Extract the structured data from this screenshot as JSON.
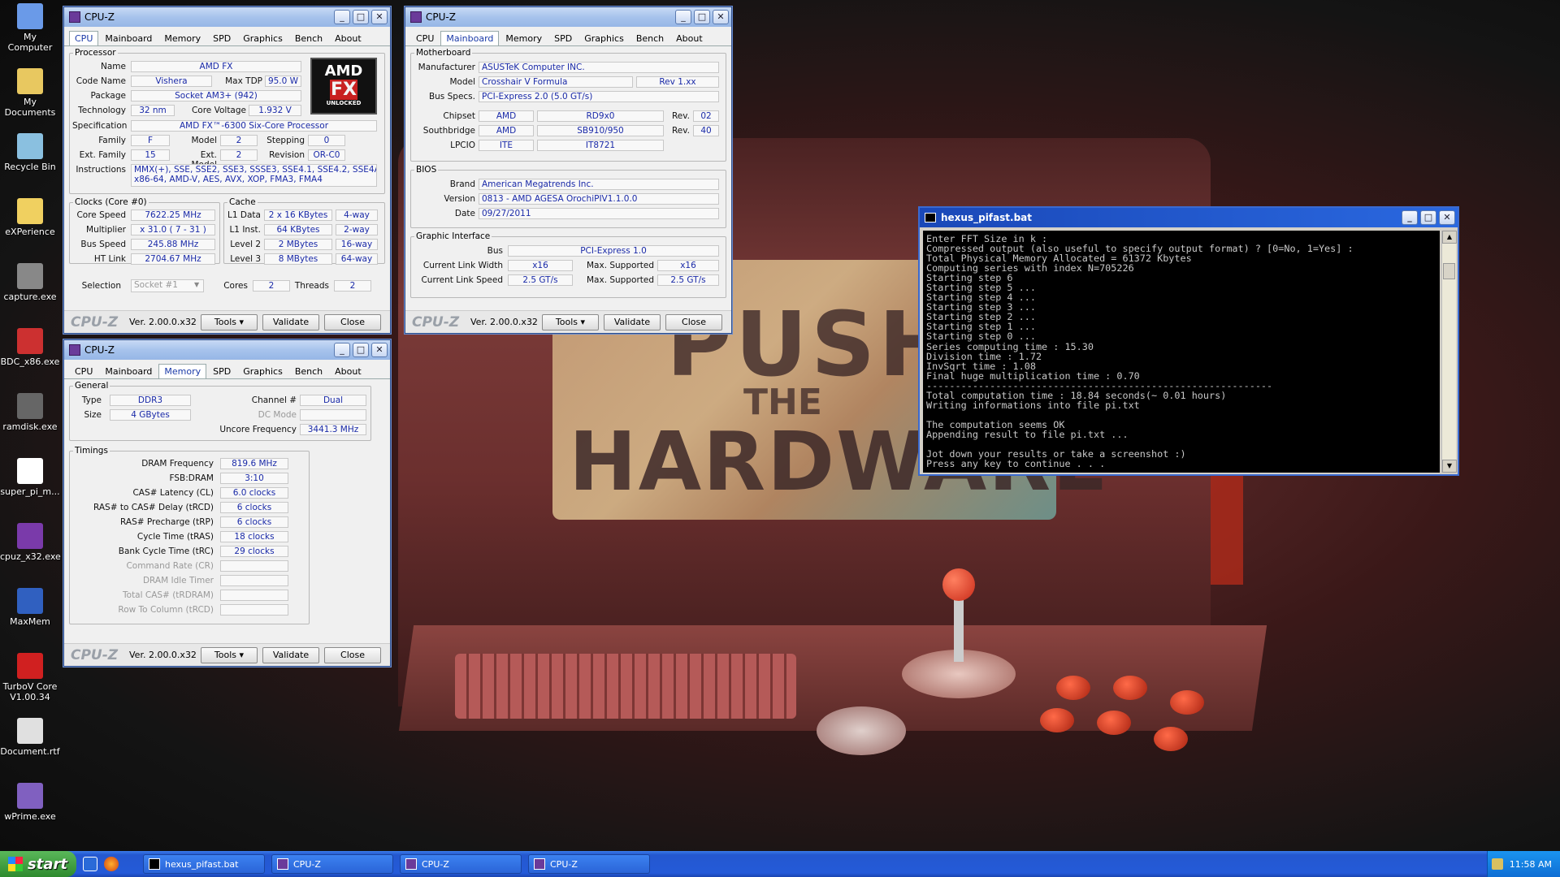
{
  "desktop": {
    "icons": [
      {
        "label": "My Computer",
        "icon": "computer-icon",
        "color": "#6a9ae8"
      },
      {
        "label": "My Documents",
        "icon": "documents-icon",
        "color": "#e8c860"
      },
      {
        "label": "Recycle Bin",
        "icon": "recycle-bin-icon",
        "color": "#8ac0e0"
      },
      {
        "label": "eXPerience",
        "icon": "folder-icon",
        "color": "#f0d060"
      },
      {
        "label": "capture.exe",
        "icon": "camera-icon",
        "color": "#888888"
      },
      {
        "label": "BDC_x86.exe",
        "icon": "app-icon",
        "color": "#cc3030"
      },
      {
        "label": "ramdisk.exe",
        "icon": "disk-icon",
        "color": "#666666"
      },
      {
        "label": "super_pi_m...",
        "icon": "pi-icon",
        "color": "#ffffff"
      },
      {
        "label": "cpuz_x32.exe",
        "icon": "cpu-icon",
        "color": "#7a3aaa"
      },
      {
        "label": "MaxMem",
        "icon": "memory-icon",
        "color": "#3060c0"
      },
      {
        "label": "TurboV Core V1.00.34",
        "icon": "turbo-icon",
        "color": "#d02020"
      },
      {
        "label": "Document.rtf",
        "icon": "document-icon",
        "color": "#e0e0e0"
      },
      {
        "label": "wPrime.exe",
        "icon": "wprime-icon",
        "color": "#8060c0"
      }
    ],
    "wallpaper_text": {
      "line1": "PUSH",
      "line2": "THE",
      "line3": "HARDWARE"
    }
  },
  "cpuz_cpu": {
    "title": "CPU-Z",
    "tabs": [
      "CPU",
      "Mainboard",
      "Memory",
      "SPD",
      "Graphics",
      "Bench",
      "About"
    ],
    "active_tab": "CPU",
    "processor": {
      "legend": "Processor",
      "name_label": "Name",
      "name": "AMD FX",
      "codename_label": "Code Name",
      "codename": "Vishera",
      "maxtdp_label": "Max TDP",
      "maxtdp": "95.0 W",
      "package_label": "Package",
      "package": "Socket AM3+ (942)",
      "technology_label": "Technology",
      "technology": "32 nm",
      "corevoltage_label": "Core Voltage",
      "corevoltage": "1.932 V",
      "spec_label": "Specification",
      "spec": "AMD FX™-6300 Six-Core Processor",
      "family_label": "Family",
      "family": "F",
      "model_label": "Model",
      "model": "2",
      "stepping_label": "Stepping",
      "stepping": "0",
      "extfamily_label": "Ext. Family",
      "extfamily": "15",
      "extmodel_label": "Ext. Model",
      "extmodel": "2",
      "revision_label": "Revision",
      "revision": "OR-C0",
      "instructions_label": "Instructions",
      "instructions_1": "MMX(+), SSE, SSE2, SSE3, SSSE3, SSE4.1, SSE4.2, SSE4A,",
      "instructions_2": "x86-64, AMD-V, AES, AVX, XOP, FMA3, FMA4",
      "logo_top": "AMD",
      "logo_mid": "FX",
      "logo_bottom": "UNLOCKED"
    },
    "clocks": {
      "legend": "Clocks (Core #0)",
      "corespeed_label": "Core Speed",
      "corespeed": "7622.25 MHz",
      "multiplier_label": "Multiplier",
      "multiplier": "x 31.0 ( 7 - 31 )",
      "busspeed_label": "Bus Speed",
      "busspeed": "245.88 MHz",
      "htlink_label": "HT Link",
      "htlink": "2704.67 MHz"
    },
    "cache": {
      "legend": "Cache",
      "l1d_label": "L1 Data",
      "l1d": "2 x 16 KBytes",
      "l1d_way": "4-way",
      "l1i_label": "L1 Inst.",
      "l1i": "64 KBytes",
      "l1i_way": "2-way",
      "l2_label": "Level 2",
      "l2": "2 MBytes",
      "l2_way": "16-way",
      "l3_label": "Level 3",
      "l3": "8 MBytes",
      "l3_way": "64-way"
    },
    "selection_label": "Selection",
    "selection": "Socket #1",
    "cores_label": "Cores",
    "cores": "2",
    "threads_label": "Threads",
    "threads": "2",
    "footer": {
      "logo": "CPU-Z",
      "version": "Ver. 2.00.0.x32",
      "tools": "Tools",
      "validate": "Validate",
      "close": "Close"
    }
  },
  "cpuz_mb": {
    "title": "CPU-Z",
    "tabs": [
      "CPU",
      "Mainboard",
      "Memory",
      "SPD",
      "Graphics",
      "Bench",
      "About"
    ],
    "active_tab": "Mainboard",
    "motherboard": {
      "legend": "Motherboard",
      "manufacturer_label": "Manufacturer",
      "manufacturer": "ASUSTeK Computer INC.",
      "model_label": "Model",
      "model": "Crosshair V Formula",
      "model_rev": "Rev 1.xx",
      "busspecs_label": "Bus Specs.",
      "busspecs": "PCI-Express 2.0 (5.0 GT/s)",
      "chipset_label": "Chipset",
      "chipset_vendor": "AMD",
      "chipset": "RD9x0",
      "chipset_rev_label": "Rev.",
      "chipset_rev": "02",
      "southbridge_label": "Southbridge",
      "southbridge_vendor": "AMD",
      "southbridge": "SB910/950",
      "southbridge_rev_label": "Rev.",
      "southbridge_rev": "40",
      "lpcio_label": "LPCIO",
      "lpcio_vendor": "ITE",
      "lpcio": "IT8721"
    },
    "bios": {
      "legend": "BIOS",
      "brand_label": "Brand",
      "brand": "American Megatrends Inc.",
      "version_label": "Version",
      "version": "0813 - AMD AGESA OrochiPIV1.1.0.0",
      "date_label": "Date",
      "date": "09/27/2011"
    },
    "graphic": {
      "legend": "Graphic Interface",
      "bus_label": "Bus",
      "bus": "PCI-Express 1.0",
      "linkwidth_label": "Current Link Width",
      "linkwidth": "x16",
      "maxsup1_label": "Max. Supported",
      "maxsup1": "x16",
      "linkspeed_label": "Current Link Speed",
      "linkspeed": "2.5 GT/s",
      "maxsup2_label": "Max. Supported",
      "maxsup2": "2.5 GT/s"
    },
    "footer": {
      "logo": "CPU-Z",
      "version": "Ver. 2.00.0.x32",
      "tools": "Tools",
      "validate": "Validate",
      "close": "Close"
    }
  },
  "cpuz_mem": {
    "title": "CPU-Z",
    "tabs": [
      "CPU",
      "Mainboard",
      "Memory",
      "SPD",
      "Graphics",
      "Bench",
      "About"
    ],
    "active_tab": "Memory",
    "general": {
      "legend": "General",
      "type_label": "Type",
      "type": "DDR3",
      "channel_label": "Channel #",
      "channel": "Dual",
      "size_label": "Size",
      "size": "4 GBytes",
      "dcmode_label": "DC Mode",
      "uncore_label": "Uncore Frequency",
      "uncore": "3441.3 MHz"
    },
    "timings": {
      "legend": "Timings",
      "rows": [
        {
          "label": "DRAM Frequency",
          "value": "819.6 MHz"
        },
        {
          "label": "FSB:DRAM",
          "value": "3:10"
        },
        {
          "label": "CAS# Latency (CL)",
          "value": "6.0 clocks"
        },
        {
          "label": "RAS# to CAS# Delay (tRCD)",
          "value": "6 clocks"
        },
        {
          "label": "RAS# Precharge (tRP)",
          "value": "6 clocks"
        },
        {
          "label": "Cycle Time (tRAS)",
          "value": "18 clocks"
        },
        {
          "label": "Bank Cycle Time (tRC)",
          "value": "29 clocks"
        },
        {
          "label": "Command Rate (CR)",
          "value": ""
        },
        {
          "label": "DRAM Idle Timer",
          "value": ""
        },
        {
          "label": "Total CAS# (tRDRAM)",
          "value": ""
        },
        {
          "label": "Row To Column (tRCD)",
          "value": ""
        }
      ]
    },
    "footer": {
      "logo": "CPU-Z",
      "version": "Ver. 2.00.0.x32",
      "tools": "Tools",
      "validate": "Validate",
      "close": "Close"
    }
  },
  "console": {
    "title": "hexus_pifast.bat",
    "lines": [
      "Enter FFT Size in k :",
      "Compressed output (also useful to specify output format) ? [0=No, 1=Yes] :",
      "Total Physical Memory Allocated = 61372 Kbytes",
      "Computing series with index N=705226",
      "Starting step 6",
      "Starting step 5 ...",
      "Starting step 4 ...",
      "Starting step 3 ...",
      "Starting step 2 ...",
      "Starting step 1 ...",
      "Starting step 0 ...",
      "Series computing time : 15.30",
      "Division time : 1.72",
      "InvSqrt time : 1.08",
      "Final huge multiplication time : 0.70",
      "------------------------------------------------------------",
      "Total computation time : 18.84 seconds(~ 0.01 hours)",
      "Writing informations into file pi.txt",
      "",
      "The computation seems OK",
      "Appending result to file pi.txt ...",
      "",
      "Jot down your results or take a screenshot :)",
      "Press any key to continue . . ."
    ]
  },
  "taskbar": {
    "start": "start",
    "buttons": [
      "hexus_pifast.bat",
      "CPU-Z",
      "CPU-Z",
      "CPU-Z"
    ],
    "clock": "11:58 AM"
  }
}
